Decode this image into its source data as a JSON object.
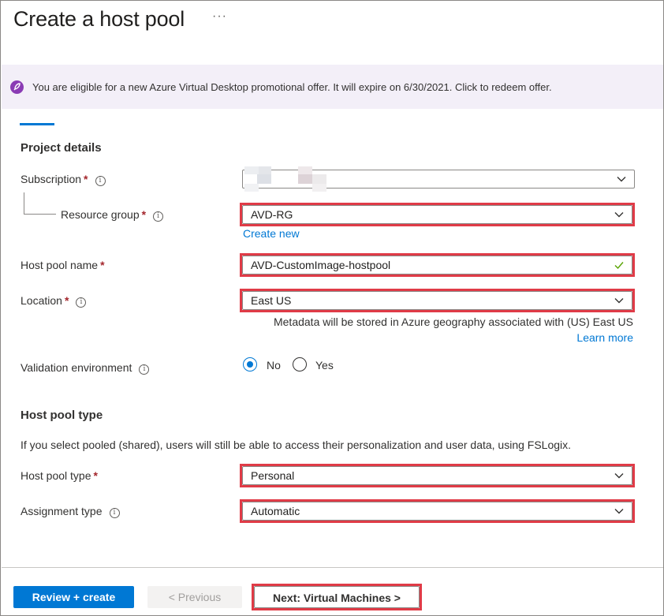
{
  "header": {
    "title": "Create a host pool",
    "more": "···"
  },
  "banner": {
    "text": "You are eligible for a new Azure Virtual Desktop promotional offer.  It will expire on 6/30/2021.  Click to redeem offer."
  },
  "project": {
    "heading": "Project details",
    "subscription_label": "Subscription",
    "subscription_value": "",
    "resource_group_label": "Resource group",
    "resource_group_value": "AVD-RG",
    "create_new": "Create new",
    "host_pool_name_label": "Host pool name",
    "host_pool_name_value": "AVD-CustomImage-hostpool",
    "location_label": "Location",
    "location_value": "East US",
    "location_helper": "Metadata will be stored in Azure geography associated with (US) East US",
    "learn_more": "Learn more",
    "validation_label": "Validation environment",
    "validation_options": [
      "No",
      "Yes"
    ],
    "validation_selected": "No"
  },
  "pool_type": {
    "heading": "Host pool type",
    "description": "If you select pooled (shared), users will still be able to access their personalization and user data, using FSLogix.",
    "type_label": "Host pool type",
    "type_value": "Personal",
    "assignment_label": "Assignment type",
    "assignment_value": "Automatic"
  },
  "footer": {
    "review_create": "Review + create",
    "previous": "< Previous",
    "next": "Next: Virtual Machines >"
  },
  "colors": {
    "accent": "#0078d4",
    "highlight": "#e03b47",
    "required": "#a4262c",
    "banner_bg": "#f3eff8",
    "valid": "#57a300"
  },
  "required_mark": "*",
  "info_glyph": "i"
}
